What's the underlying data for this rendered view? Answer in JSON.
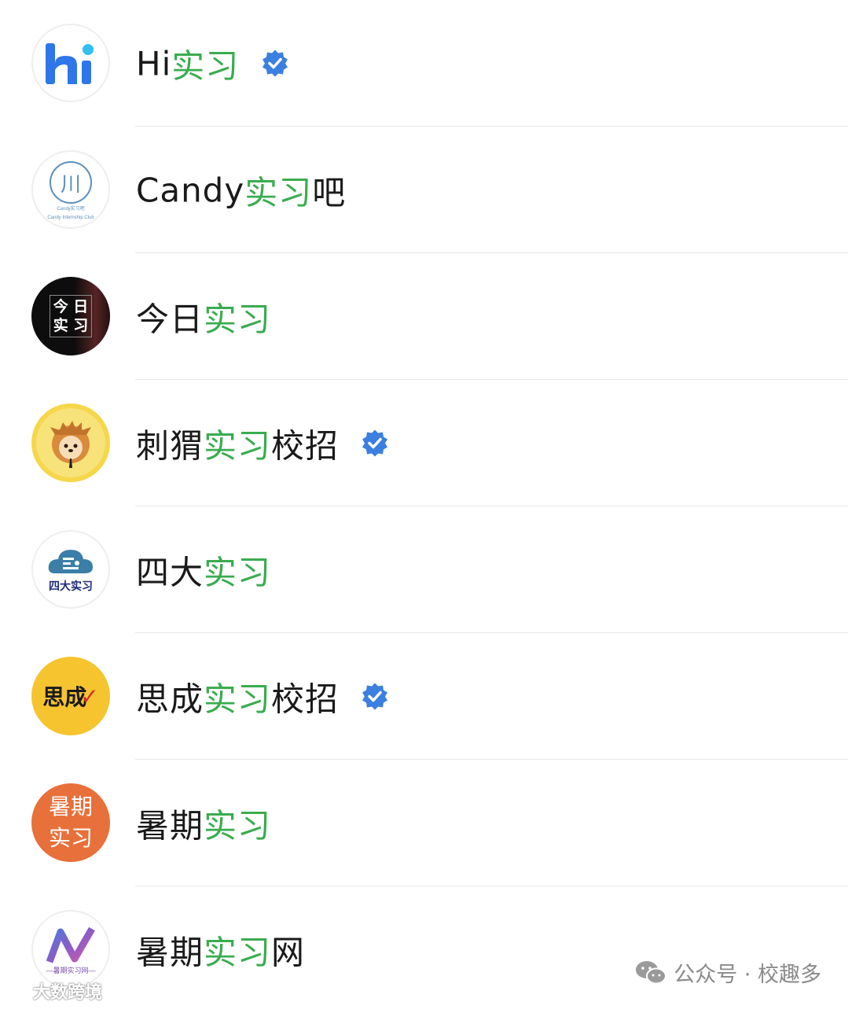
{
  "accounts": [
    {
      "name_prefix": "Hi",
      "name_green": "实习",
      "name_suffix": "",
      "verified": true,
      "avatar_icon": "hi-logo-icon"
    },
    {
      "name_prefix": "Candy ",
      "name_green": "实习",
      "name_suffix": "吧",
      "verified": false,
      "avatar_icon": "candy-logo-icon",
      "avatar_glyph": "川",
      "avatar_small_1": "Candy实习吧",
      "avatar_small_2": "Candy Internship Club"
    },
    {
      "name_prefix": "今日",
      "name_green": "实习",
      "name_suffix": "",
      "verified": false,
      "avatar_icon": "jinri-logo-icon",
      "avatar_line_1": "今 日",
      "avatar_line_2": "实 习"
    },
    {
      "name_prefix": "刺猬",
      "name_green": "实习",
      "name_suffix": "校招",
      "verified": true,
      "avatar_icon": "hedgehog-logo-icon"
    },
    {
      "name_prefix": "四大",
      "name_green": "实习",
      "name_suffix": "",
      "verified": false,
      "avatar_icon": "sida-logo-icon",
      "avatar_text": "四大实习"
    },
    {
      "name_prefix": "思成",
      "name_green": "实习",
      "name_suffix": "校招",
      "verified": true,
      "avatar_icon": "sicheng-logo-icon",
      "avatar_text": "思成",
      "avatar_mark": "✓"
    },
    {
      "name_prefix": "暑期",
      "name_green": "实习",
      "name_suffix": "",
      "verified": false,
      "avatar_icon": "summer-logo-icon",
      "avatar_line_1": "暑期",
      "avatar_line_2": "实习"
    },
    {
      "name_prefix": "暑期",
      "name_green": "实习",
      "name_suffix": "网",
      "verified": false,
      "avatar_icon": "summer-net-logo-icon",
      "avatar_text": "—暑期实习网—"
    }
  ],
  "watermark_left": "大数跨境",
  "watermark_right": "公众号 · 校趣多",
  "colors": {
    "green": "#3aac4f",
    "verify_blue": "#3b7fe0",
    "divider": "#e6e6e6"
  }
}
